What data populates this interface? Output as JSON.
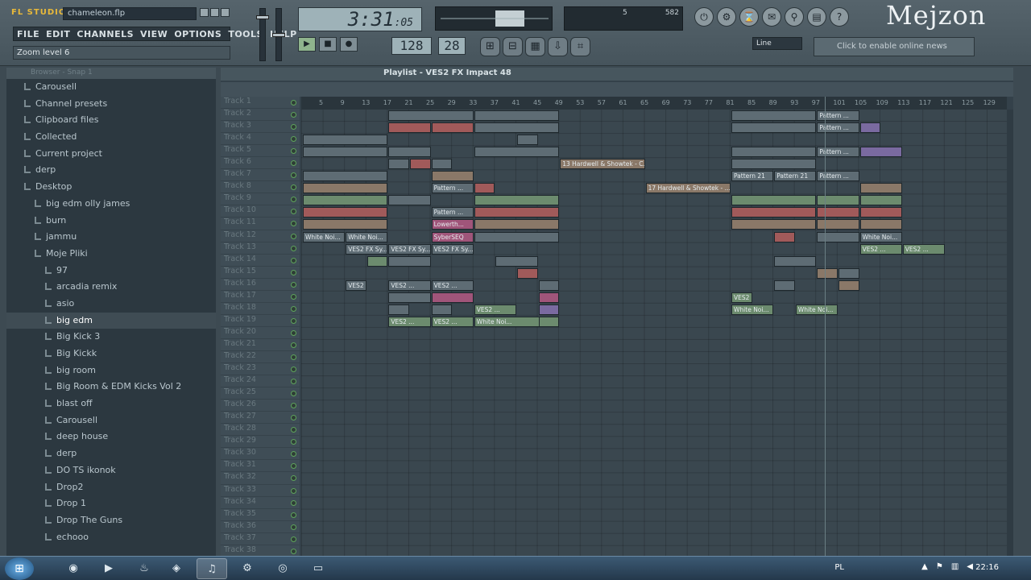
{
  "app": {
    "logo": "FL STUDIO",
    "file_name": "chameleon.flp",
    "watermark": "Mejzon"
  },
  "menu": [
    "FILE",
    "EDIT",
    "CHANNELS",
    "VIEW",
    "OPTIONS",
    "TOOLS",
    "HELP"
  ],
  "hint": "Zoom level 6",
  "time": {
    "main": "3:31",
    "sub": "05"
  },
  "tempo": "128",
  "pattern": "28",
  "cpu": "5",
  "mem": "582",
  "snap": "Line",
  "news": "Click to enable online news",
  "transport": {
    "play": "▶",
    "stop": "■",
    "record": "●"
  },
  "tools": [
    "⊞",
    "⊟",
    "▦",
    "⇩",
    "⌗"
  ],
  "shortcuts": [
    "⏻",
    "⚙",
    "⌛",
    "✉",
    "⚲",
    "▤",
    "?"
  ],
  "browser": {
    "header": "Browser - Snap 1",
    "items": [
      {
        "label": "Carousell",
        "indent": 1
      },
      {
        "label": "Channel presets",
        "indent": 1
      },
      {
        "label": "Clipboard files",
        "indent": 1
      },
      {
        "label": "Collected",
        "indent": 1
      },
      {
        "label": "Current project",
        "indent": 1
      },
      {
        "label": "derp",
        "indent": 1
      },
      {
        "label": "Desktop",
        "indent": 1
      },
      {
        "label": "big edm olly james",
        "indent": 2
      },
      {
        "label": "burn",
        "indent": 2
      },
      {
        "label": "jammu",
        "indent": 2
      },
      {
        "label": "Moje Pliki",
        "indent": 2
      },
      {
        "label": "97",
        "indent": 3
      },
      {
        "label": "arcadia remix",
        "indent": 3
      },
      {
        "label": "asio",
        "indent": 3
      },
      {
        "label": "big edm",
        "indent": 3,
        "selected": true
      },
      {
        "label": "Big Kick 3",
        "indent": 3
      },
      {
        "label": "Big Kickk",
        "indent": 3
      },
      {
        "label": "big room",
        "indent": 3
      },
      {
        "label": "Big Room & EDM Kicks Vol 2",
        "indent": 3
      },
      {
        "label": "blast off",
        "indent": 3
      },
      {
        "label": "Carousell",
        "indent": 3
      },
      {
        "label": "deep house",
        "indent": 3
      },
      {
        "label": "derp",
        "indent": 3
      },
      {
        "label": "DO TS ikonok",
        "indent": 3
      },
      {
        "label": "Drop2",
        "indent": 3
      },
      {
        "label": "Drop 1",
        "indent": 3
      },
      {
        "label": "Drop The Guns",
        "indent": 3
      },
      {
        "label": "echooo",
        "indent": 3
      }
    ]
  },
  "playlist": {
    "title": "Playlist - VES2 FX Impact 48",
    "ruler": [
      "5",
      "9",
      "13",
      "17",
      "21",
      "25",
      "29",
      "33",
      "37",
      "41",
      "45",
      "49",
      "53",
      "57",
      "61",
      "65",
      "69",
      "73",
      "77",
      "81",
      "85",
      "89",
      "93",
      "97",
      "101",
      "105",
      "109",
      "113",
      "117",
      "121",
      "125",
      "129"
    ],
    "tracks": [
      "Track 1",
      "Track 2",
      "Track 3",
      "Track 4",
      "Track 5",
      "Track 6",
      "Track 7",
      "Track 8",
      "Track 9",
      "Track 10",
      "Track 11",
      "Track 12",
      "Track 13",
      "Track 14",
      "Track 15",
      "Track 16",
      "Track 17",
      "Track 18",
      "Track 19",
      "Track 20",
      "Track 21",
      "Track 22",
      "Track 23",
      "Track 24",
      "Track 25",
      "Track 26",
      "Track 27",
      "Track 28",
      "Track 29",
      "Track 30",
      "Track 31",
      "Track 32",
      "Track 33",
      "Track 34",
      "Track 35",
      "Track 36",
      "Track 37",
      "Track 38"
    ],
    "clip_labels": [
      "Pattern ...",
      "13 Hardwell & Showtek - C...",
      "17 Hardwell & Showtek - ...",
      "Pattern 21",
      "White Noi...",
      "VES2 FX Sy...",
      "SyberSEQ",
      "Lowerth...",
      "VES2 ...",
      "White Noi..."
    ]
  },
  "taskbar": {
    "lang": "PL",
    "clock": "22:16"
  },
  "colors": {
    "accent": "#e8b93a",
    "clip_red": "#a15a5a",
    "clip_green": "#6c8b6e"
  }
}
